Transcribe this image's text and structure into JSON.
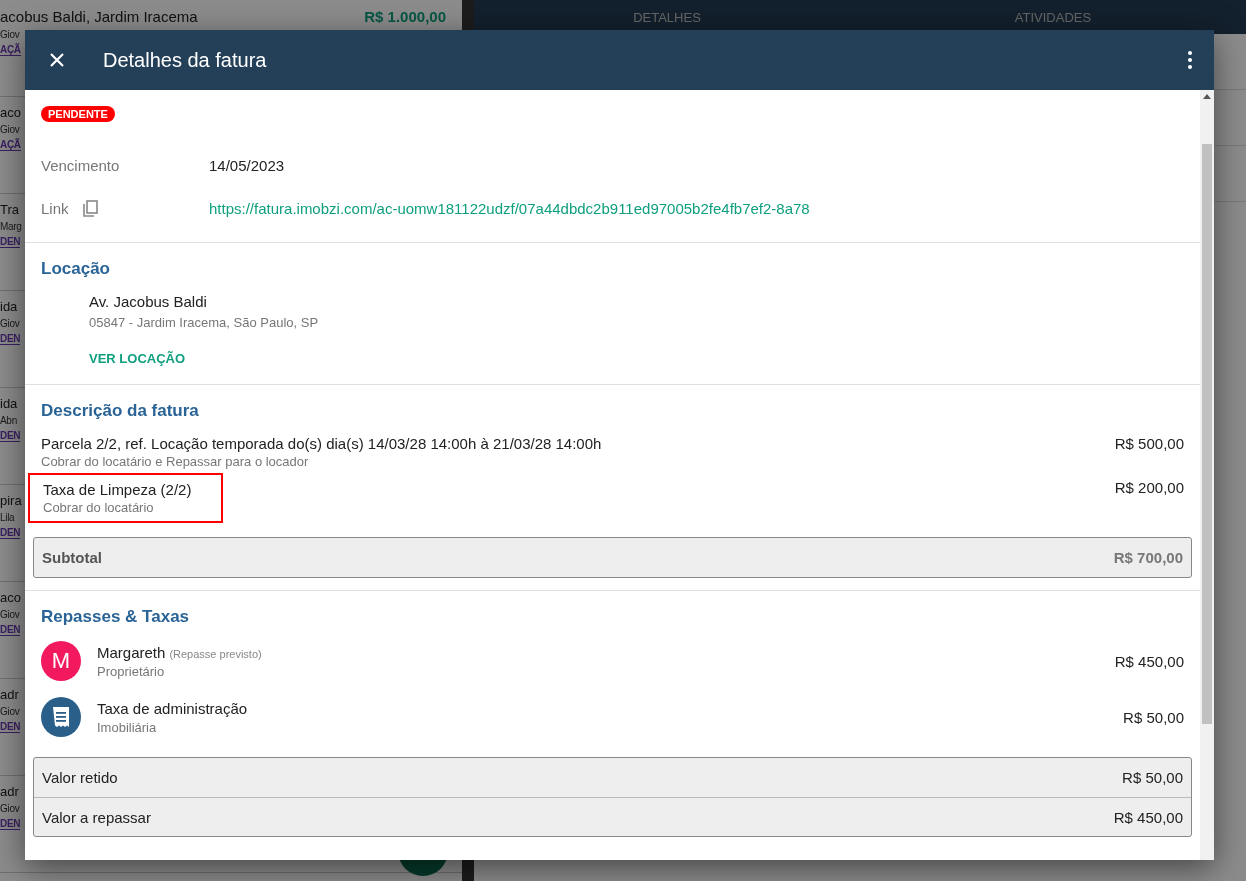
{
  "background": {
    "tabs": [
      {
        "label": "DETALHES",
        "selected": false
      },
      {
        "label": "ATIVIDADES",
        "selected": false
      }
    ],
    "list": [
      {
        "title": "acobus Baldi, Jardim Iracema",
        "amount": "R$ 1.000,00",
        "line_2": "Giov",
        "tag": "AÇÃ"
      },
      {
        "title": "aco",
        "line_2": "Giov",
        "tag": "AÇÃ"
      },
      {
        "title": "Tra",
        "line_2": "Marg",
        "tag": "DEN"
      },
      {
        "title": "ida",
        "line_2": "Giov",
        "tag": "DEN"
      },
      {
        "title": "ida",
        "line_2": "Abn",
        "tag": "DEN"
      },
      {
        "title": "pira",
        "line_2": "Lila",
        "tag": "DEN"
      },
      {
        "title": "aco",
        "line_2": "Giov",
        "tag": "DEN"
      },
      {
        "title": "adr",
        "line_2": "Giov",
        "tag": "DEN"
      },
      {
        "title": "adr",
        "line_2": "Giov",
        "tag": "DEN"
      }
    ]
  },
  "dialog": {
    "title": "Detalhes da fatura",
    "status": "PENDENTE",
    "fields": [
      {
        "label": "Vencimento",
        "value": "14/05/2023",
        "kind": "text"
      },
      {
        "label": "Link",
        "value": "https://fatura.imobzi.com/ac-uomw181122udzf/07a44dbdc2b911ed97005b2fe4fb7ef2-8a78",
        "kind": "link"
      }
    ],
    "location": {
      "heading": "Locação",
      "street": "Av. Jacobus Baldi",
      "address": "05847 - Jardim Iracema, São Paulo, SP",
      "button": "VER LOCAÇÃO"
    },
    "description": {
      "heading": "Descrição da fatura",
      "items": [
        {
          "title": "Parcela 2/2, ref. Locação temporada do(s) dia(s) 14/03/28 14:00h à 21/03/28 14:00h",
          "subtitle": "Cobrar do locatário e Repassar para o locador",
          "amount": "R$ 500,00",
          "highlighted": false
        },
        {
          "title": "Taxa de Limpeza (2/2)",
          "subtitle": "Cobrar do locatário",
          "amount": "R$ 200,00",
          "highlighted": true
        }
      ],
      "subtotal": {
        "label": "Subtotal",
        "amount": "R$ 700,00"
      }
    },
    "transfers": {
      "heading": "Repasses & Taxas",
      "items": [
        {
          "kind": "letter",
          "avatar": "M",
          "color": "#f2195f",
          "name": "Margareth",
          "note": "(Repasse previsto)",
          "role": "Proprietário",
          "amount": "R$ 450,00"
        },
        {
          "kind": "icon",
          "color": "#2a5f8a",
          "name": "Taxa de administração",
          "role": "Imobiliária",
          "amount": "R$ 50,00"
        }
      ],
      "totals": [
        {
          "label": "Valor retido",
          "amount": "R$ 50,00"
        },
        {
          "label": "Valor a repassar",
          "amount": "R$ 450,00"
        }
      ]
    }
  }
}
